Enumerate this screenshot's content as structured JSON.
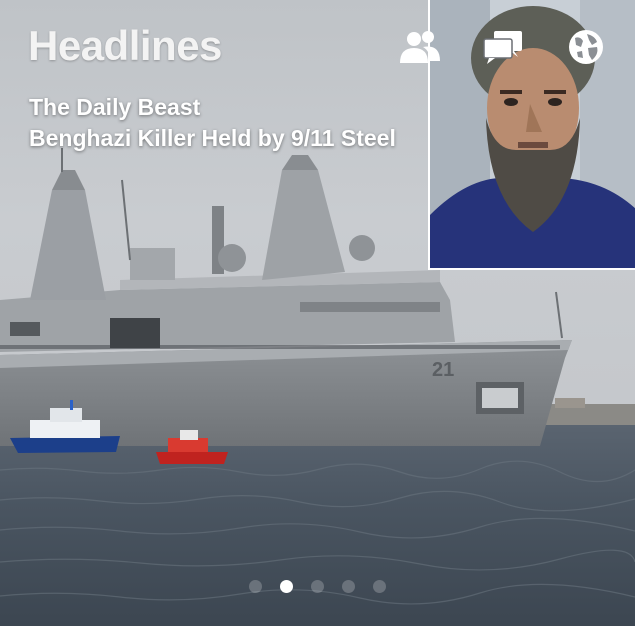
{
  "header": {
    "section_title": "Headlines",
    "icons": [
      "people-icon",
      "chat-bubbles-icon",
      "globe-icon"
    ]
  },
  "article": {
    "source": "The Daily Beast",
    "headline": "Benghazi Killer Held by 9/11 Steel"
  },
  "ship": {
    "hull_number": "21"
  },
  "pager": {
    "page_count": 5,
    "active_index": 1
  },
  "colors": {
    "title_text": "#f3f3f3",
    "headline_text": "#ffffff",
    "inset_border": "#ffffff",
    "active_dot": "#ffffff"
  }
}
